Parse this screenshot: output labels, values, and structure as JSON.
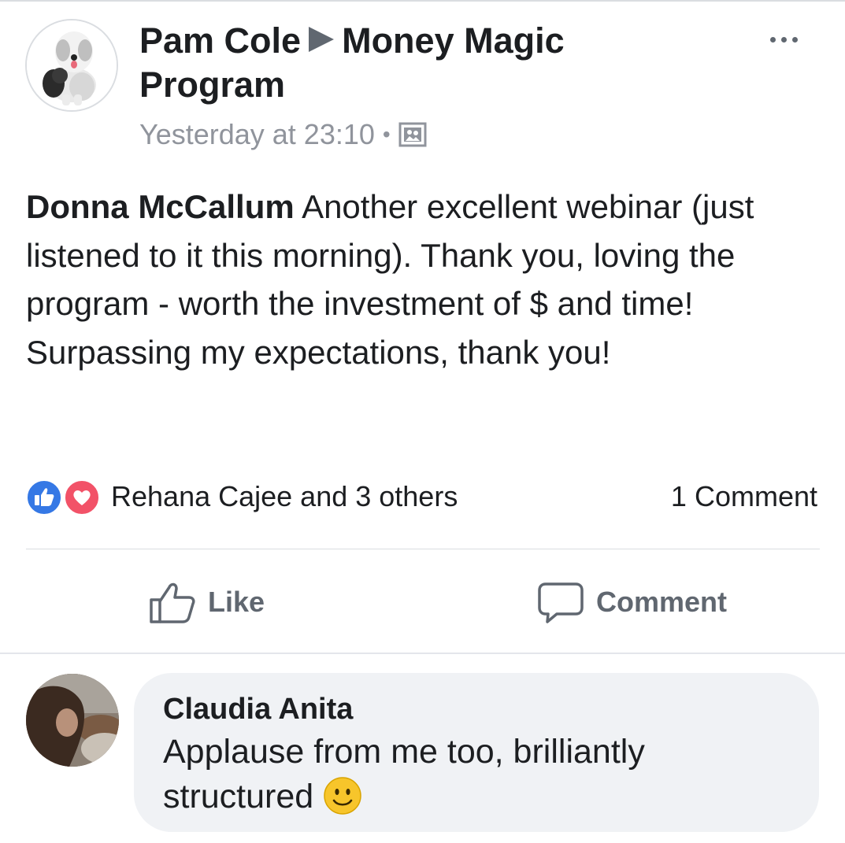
{
  "post": {
    "author": "Pam Cole",
    "group": "Money Magic Program",
    "timestamp": "Yesterday at 23:10",
    "separator": "•",
    "privacy_icon": "photo-album-icon",
    "text_author": "Donna McCallum",
    "text_body": "Another excellent webinar (just listened to it this morning). Thank you, loving the program - worth the investment of $ and time! Surpassing my expectations, thank you!"
  },
  "reactions": {
    "icons": [
      "like-reaction-icon",
      "love-reaction-icon"
    ],
    "names": "Rehana Cajee and 3 others",
    "comment_count": "1 Comment"
  },
  "actions": {
    "like_label": "Like",
    "comment_label": "Comment"
  },
  "comment": {
    "author": "Claudia Anita",
    "text": "Applause from me too, brilliantly structured"
  },
  "colors": {
    "like_blue": "#3578e5",
    "love_red": "#f25268",
    "muted_gray": "#606770",
    "bubble_bg": "#f0f2f5"
  }
}
